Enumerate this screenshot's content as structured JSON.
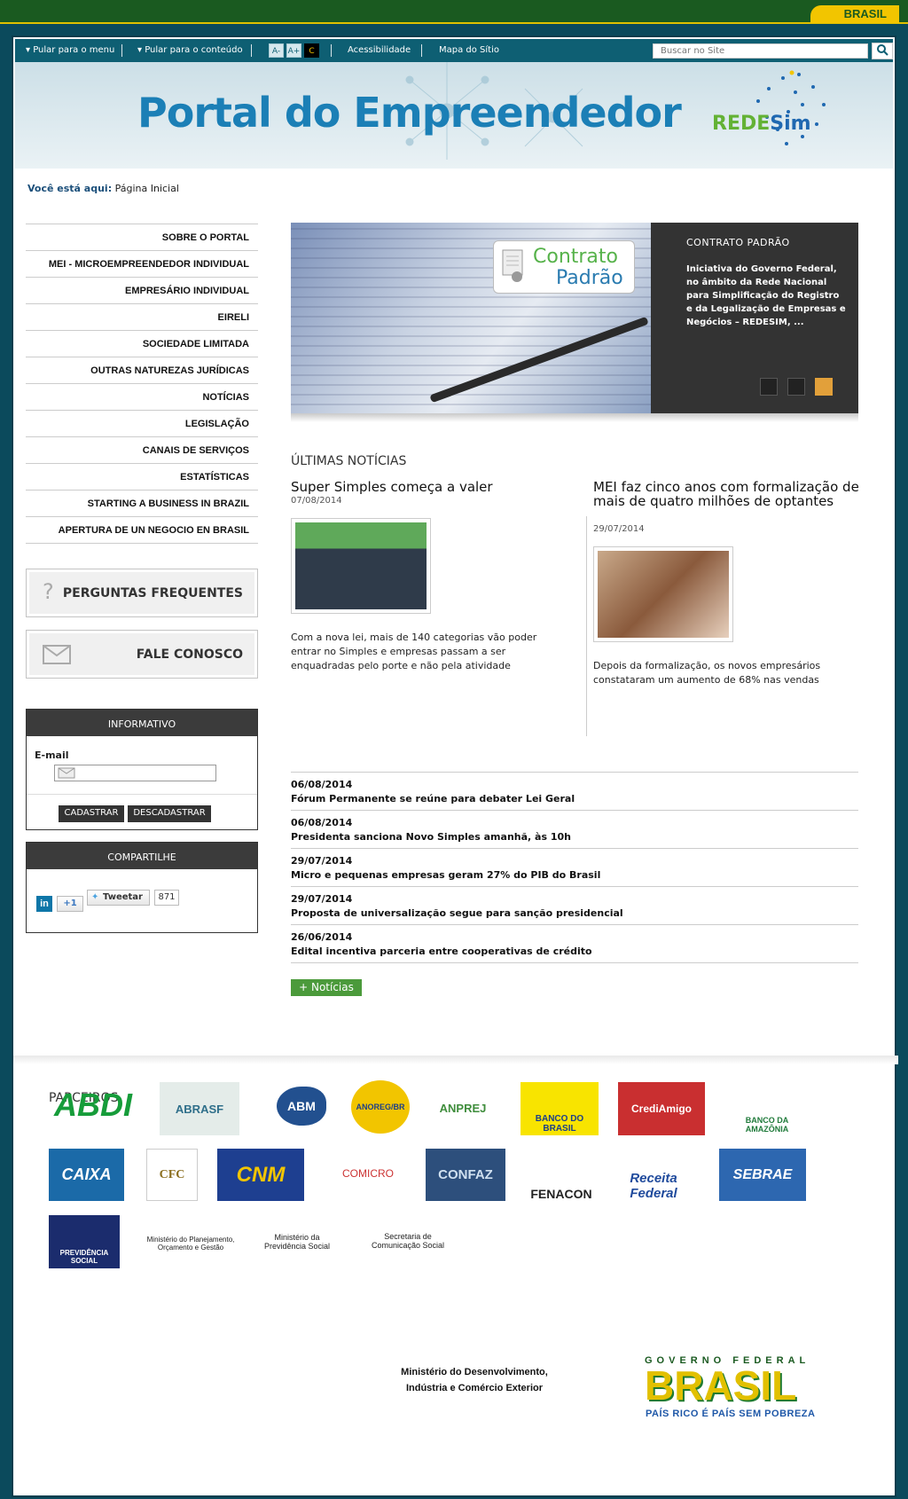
{
  "gov_bar": {
    "brand": "BRASIL"
  },
  "top_nav": {
    "skip_menu": "▾ Pular para o menu",
    "skip_content": "▾ Pular para o conteúdo",
    "font_smaller": "A-",
    "font_larger": "A+",
    "contrast": "C",
    "accessibility": "Acessibilidade",
    "sitemap": "Mapa do Sítio",
    "search_placeholder": "Buscar no Site"
  },
  "banner": {
    "title": "Portal do Empreendedor",
    "logo_text_a": "REDE",
    "logo_text_b": "Sim"
  },
  "breadcrumb": {
    "label": "Você está aqui:",
    "current": "Página Inicial"
  },
  "left_nav": [
    "SOBRE O PORTAL",
    "MEI - MICROEMPREENDEDOR INDIVIDUAL",
    "EMPRESÁRIO INDIVIDUAL",
    "EIRELI",
    "SOCIEDADE LIMITADA",
    "OUTRAS NATUREZAS JURÍDICAS",
    "NOTÍCIAS",
    "LEGISLAÇÃO",
    "CANAIS DE SERVIÇOS",
    "ESTATÍSTICAS",
    "STARTING A BUSINESS IN BRAZIL",
    "APERTURA DE UN NEGOCIO EN BRASIL"
  ],
  "faq_button": "PERGUNTAS FREQUENTES",
  "contact_button": "FALE CONOSCO",
  "informativo": {
    "title": "INFORMATIVO",
    "email_label": "E-mail",
    "subscribe": "CADASTRAR",
    "unsubscribe": "DESCADASTRAR"
  },
  "compartilhe": {
    "title": "COMPARTILHE",
    "gplus": "+1",
    "tweet": "Tweetar",
    "tweet_count": "871"
  },
  "slider": {
    "badge_line1": "Contrato",
    "badge_line2": "Padrão",
    "title": "CONTRATO PADRÃO",
    "text": "Iniciativa do Governo Federal, no âmbito da Rede Nacional para Simplificação do Registro e da Legalização de Empresas e Negócios – REDESIM, ...",
    "active_dot": 3
  },
  "ultimas_noticias": "ÚLTIMAS NOTÍCIAS",
  "featured": [
    {
      "title": "Super Simples começa a valer",
      "date": "07/08/2014",
      "body": "Com a nova lei, mais de 140 categorias vão poder entrar no Simples e empresas passam a ser enquadradas pelo porte e não pela atividade"
    },
    {
      "title": "MEI faz cinco anos com formalização de mais de quatro milhões de optantes",
      "date": "29/07/2014",
      "body": "Depois da formalização, os novos empresários constataram um aumento de 68% nas vendas"
    }
  ],
  "news_list": [
    {
      "date": "06/08/2014",
      "title": "Fórum Permanente se reúne para debater Lei Geral"
    },
    {
      "date": "06/08/2014",
      "title": "Presidenta sanciona Novo Simples amanhã, às 10h"
    },
    {
      "date": "29/07/2014",
      "title": "Micro e pequenas empresas geram 27% do PIB do Brasil"
    },
    {
      "date": "29/07/2014",
      "title": "Proposta de universalização segue para sanção presidencial"
    },
    {
      "date": "26/06/2014",
      "title": "Edital incentiva parceria entre cooperativas de crédito"
    }
  ],
  "more_news": "+ Notícias",
  "parceiros_title": "PARCEIROS",
  "partners": [
    "ABDI",
    "ABRASF",
    "ABM",
    "ANOREG/BR",
    "ANPREJ",
    "BANCO DO BRASIL",
    "CrediAmigo",
    "BANCO DA AMAZÔNIA",
    "CAIXA",
    "CFC",
    "CNM",
    "COMICRO",
    "CONFAZ",
    "FENACON",
    "Receita Federal",
    "SEBRAE",
    "PREVIDÊNCIA SOCIAL",
    "Ministério do Planejamento, Orçamento e Gestão",
    "Ministério da Previdência Social",
    "Secretaria de Comunicação Social"
  ],
  "footer": {
    "ministry": "Ministério do Desenvolvimento, Indústria e Comércio Exterior",
    "gov_top": "GOVERNO FEDERAL",
    "gov_brand": "BRASIL",
    "gov_tag": "PAÍS RICO É PAÍS SEM POBREZA"
  }
}
